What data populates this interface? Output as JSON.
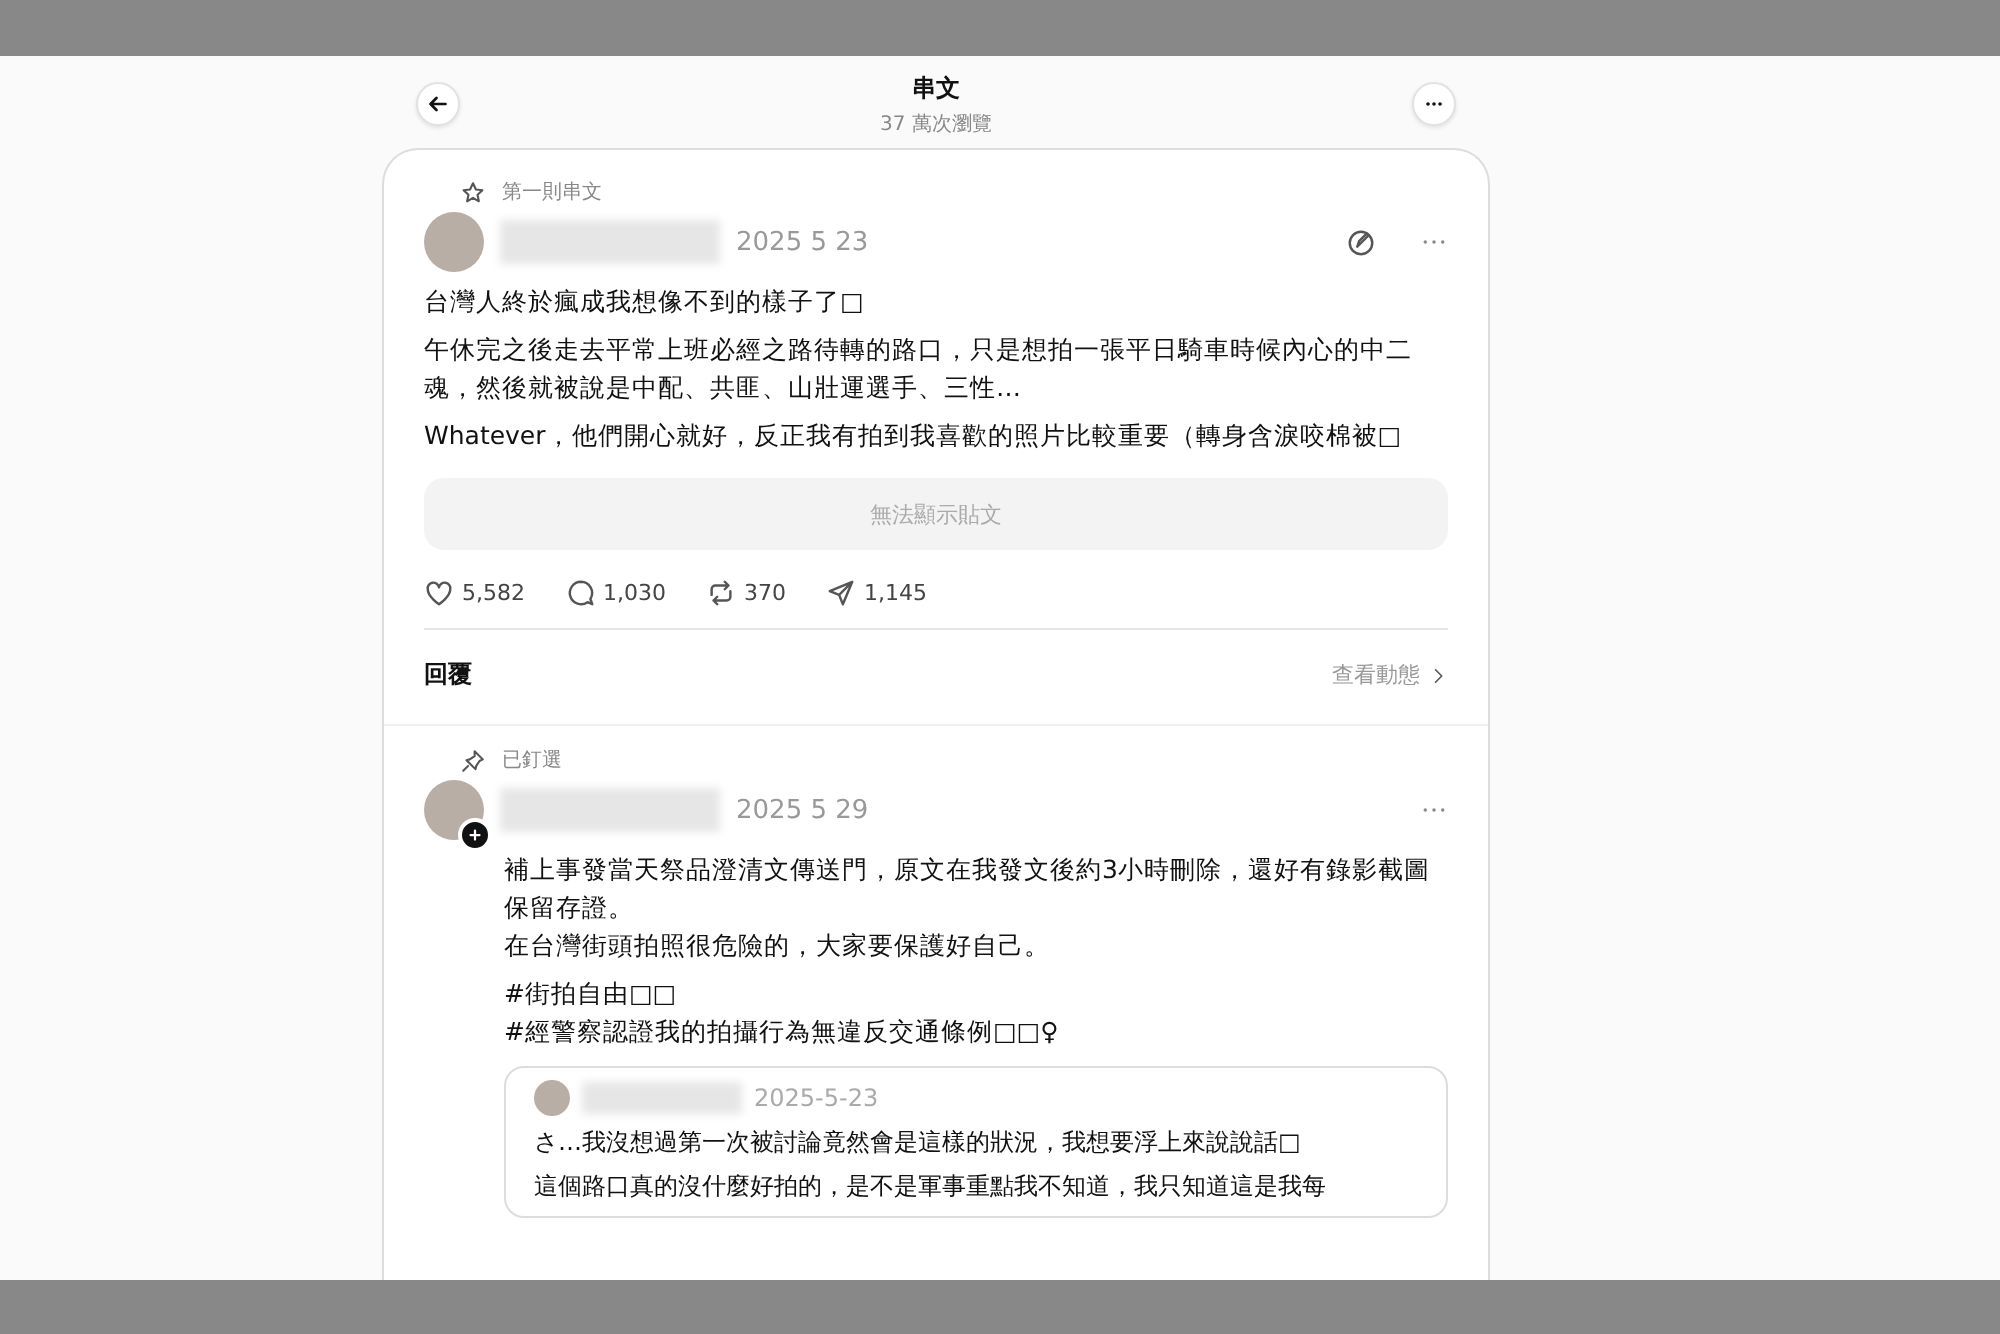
{
  "header": {
    "title": "串文",
    "subtitle": "37 萬次瀏覽"
  },
  "posts": [
    {
      "label": "第一則串文",
      "kind": "star",
      "date": "2025 5 23",
      "has_follow": false,
      "has_edit": true,
      "paragraphs": [
        [
          "台灣人終於瘋成我想像不到的樣子了□"
        ],
        [
          "午休完之後走去平常上班必經之路待轉的路口，只是想拍一張平日騎車時候內心的中二魂，然後就被說是中配、共匪、山壯運選手、三性…"
        ],
        [
          "Whatever，他們開心就好，反正我有拍到我喜歡的照片比較重要（轉身含淚咬棉被□"
        ]
      ],
      "unavailable": "無法顯示貼文",
      "stats": {
        "likes": "5,582",
        "comments": "1,030",
        "reposts": "370",
        "shares": "1,145"
      }
    },
    {
      "label": "已釘選",
      "kind": "pin",
      "date": "2025 5 29",
      "has_follow": true,
      "has_edit": false,
      "paragraphs": [
        [
          "補上事發當天祭品澄清文傳送門，原文在我發文後約3小時刪除，還好有錄影截圖保留存證。",
          "在台灣街頭拍照很危險的，大家要保護好自己。"
        ],
        [
          "#街拍自由□□",
          "#經警察認證我的拍攝行為無違反交通條例□□♀"
        ]
      ],
      "quote": {
        "date": "2025-5-23",
        "paragraphs": [
          "さ…我沒想過第一次被討論竟然會是這樣的狀況，我想要浮上來說說話□",
          "這個路口真的沒什麼好拍的，是不是軍事重點我不知道，我只知道這是我每"
        ]
      }
    }
  ],
  "replies_bar": {
    "label": "回覆",
    "link": "查看動態"
  }
}
